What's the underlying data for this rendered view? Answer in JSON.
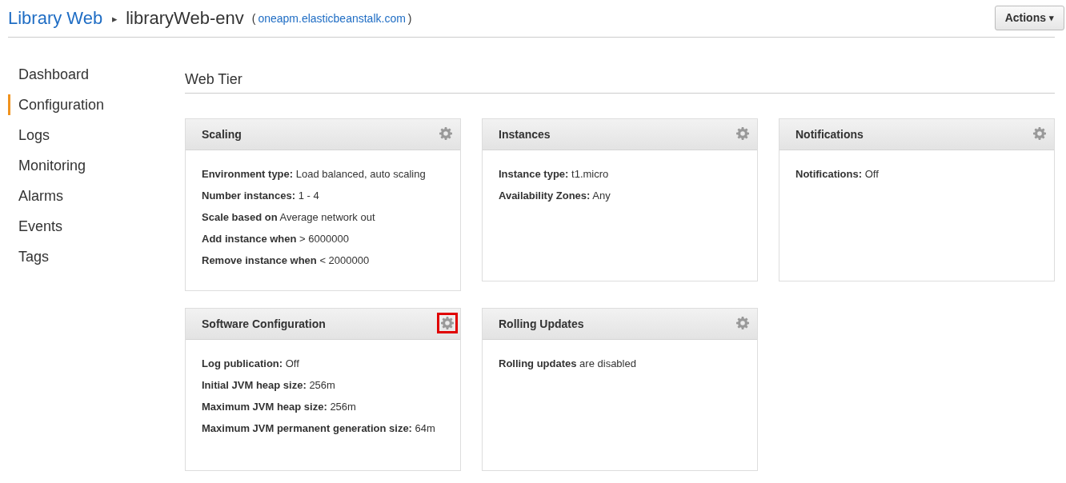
{
  "breadcrumb": {
    "application": "Library Web",
    "separator": "▸",
    "environment": "libraryWeb-env",
    "url_open": "(",
    "url": "oneapm.elasticbeanstalk.com",
    "url_close": ")"
  },
  "actions_button": {
    "label": "Actions",
    "caret": "▾"
  },
  "sidebar": {
    "items": [
      {
        "label": "Dashboard",
        "selected": false
      },
      {
        "label": "Configuration",
        "selected": true
      },
      {
        "label": "Logs",
        "selected": false
      },
      {
        "label": "Monitoring",
        "selected": false
      },
      {
        "label": "Alarms",
        "selected": false
      },
      {
        "label": "Events",
        "selected": false
      },
      {
        "label": "Tags",
        "selected": false
      }
    ]
  },
  "section_title": "Web Tier",
  "cards": [
    {
      "title": "Scaling",
      "gear_highlighted": false,
      "lines": [
        "**Environment type:** Load balanced, auto scaling",
        "**Number instances:** 1 - 4",
        "**Scale based on** Average network out",
        "**Add instance when** > 6000000",
        "**Remove instance when** < 2000000"
      ]
    },
    {
      "title": "Instances",
      "gear_highlighted": false,
      "lines": [
        "**Instance type:** t1.micro",
        "**Availability Zones:** Any"
      ]
    },
    {
      "title": "Notifications",
      "gear_highlighted": false,
      "lines": [
        "**Notifications:** Off"
      ]
    },
    {
      "title": "Software Configuration",
      "gear_highlighted": true,
      "lines": [
        "**Log publication:** Off",
        "**Initial JVM heap size:** 256m",
        "**Maximum JVM heap size:** 256m",
        "**Maximum JVM permanent generation size:** 64m"
      ]
    },
    {
      "title": "Rolling Updates",
      "gear_highlighted": false,
      "lines": [
        "**Rolling updates** are disabled"
      ]
    }
  ]
}
